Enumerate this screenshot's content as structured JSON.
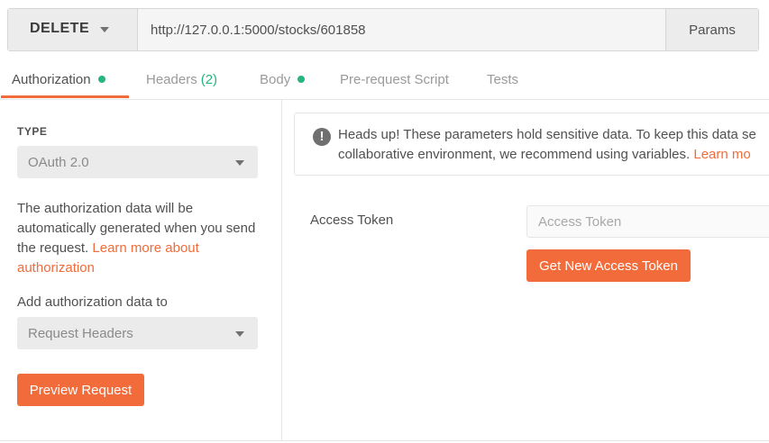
{
  "request": {
    "method": "DELETE",
    "url": "http://127.0.0.1:5000/stocks/601858",
    "params_label": "Params"
  },
  "tabs": [
    {
      "label": "Authorization",
      "indicator": "dot",
      "active": true
    },
    {
      "label": "Headers",
      "count": "(2)"
    },
    {
      "label": "Body",
      "indicator": "dot"
    },
    {
      "label": "Pre-request Script"
    },
    {
      "label": "Tests"
    }
  ],
  "left": {
    "type_label": "TYPE",
    "type_value": "OAuth 2.0",
    "description": "The authorization data will be automatically generated when you send the request.",
    "learn_more_link": "Learn more about authorization",
    "add_to_label": "Add authorization data to",
    "add_to_value": "Request Headers",
    "preview_button": "Preview Request"
  },
  "right": {
    "alert_line1": "Heads up! These parameters hold sensitive data. To keep this data se",
    "alert_line2": "collaborative environment, we recommend using variables.",
    "alert_link": "Learn mo",
    "access_token_label": "Access Token",
    "access_token_placeholder": "Access Token",
    "get_token_button": "Get New Access Token"
  },
  "colors": {
    "accent": "#f26b3a",
    "indicator_green": "#26b47f"
  },
  "icons": {
    "method_dropdown": "chevron-down-icon",
    "alert": "exclamation-circle-icon",
    "select_dropdown": "chevron-down-icon"
  }
}
